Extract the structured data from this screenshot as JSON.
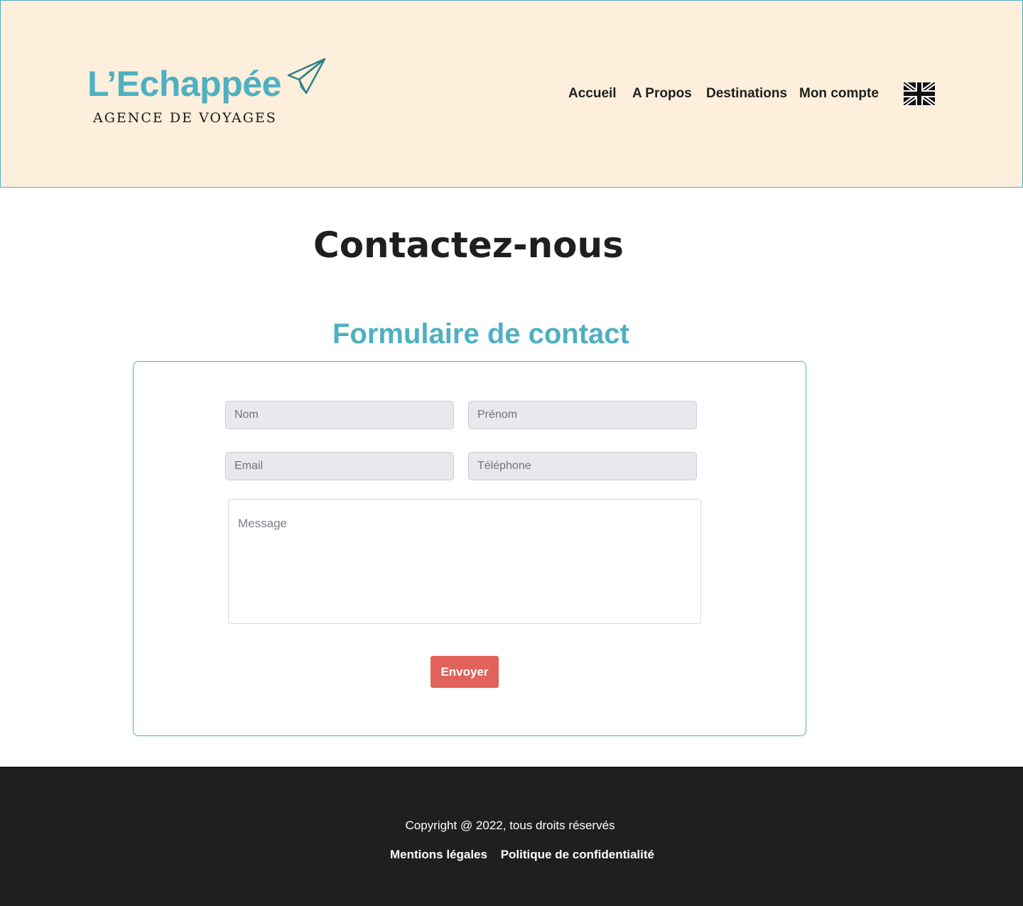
{
  "brand": {
    "name": "L’Echappée",
    "tagline": "AGENCE DE VOYAGES",
    "accent_color": "#4eb0c2",
    "logo_icon": "paper-plane-icon"
  },
  "nav": {
    "items": [
      "Accueil",
      "A Propos",
      "Destinations",
      "Mon compte"
    ],
    "language_icon": "uk-flag-icon"
  },
  "main": {
    "title": "Contactez-nous",
    "form_title": "Formulaire de contact"
  },
  "form": {
    "nom_placeholder": "Nom",
    "prenom_placeholder": "Prénom",
    "email_placeholder": "Email",
    "telephone_placeholder": "Téléphone",
    "message_placeholder": "Message",
    "submit_label": "Envoyer",
    "submit_color": "#e0625b"
  },
  "footer": {
    "copyright": "Copyright @ 2022, tous droits réservés",
    "links": [
      "Mentions légales",
      "Politique de confidentialité"
    ],
    "background": "#201f20"
  }
}
